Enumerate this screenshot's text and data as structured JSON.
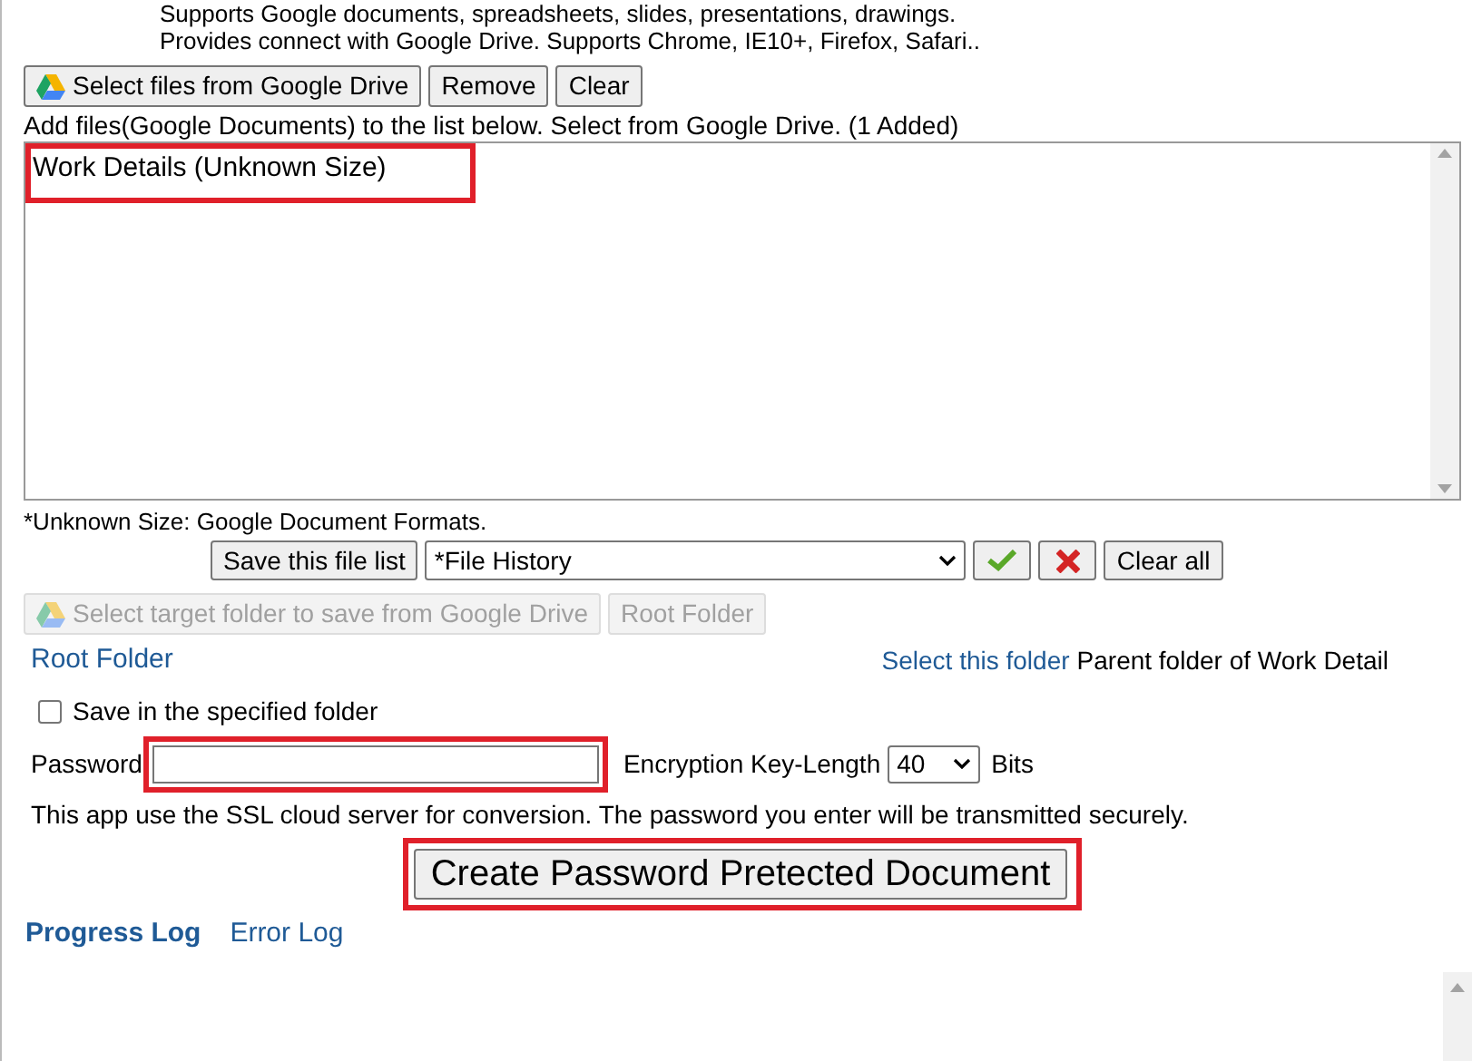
{
  "intro": [
    "Supports Google documents, spreadsheets, slides, presentations, drawings.",
    "Provides connect with Google Drive. Supports Chrome, IE10+, Firefox, Safari.."
  ],
  "file_buttons": [
    {
      "label": "Select files from Google Drive",
      "icon": true
    },
    {
      "label": "Remove",
      "icon": false
    },
    {
      "label": "Clear",
      "icon": false
    }
  ],
  "list_hint": "Add files(Google Documents) to the list below. Select from Google Drive. (1 Added)",
  "file_list": [
    {
      "label": "Work Details (Unknown Size)",
      "highlighted": true
    }
  ],
  "note": "*Unknown Size: Google Document Formats.",
  "history": {
    "save_button": "Save this file list",
    "select_value": "*File History",
    "clear_button": "Clear all"
  },
  "folder_buttons": [
    {
      "label": "Select target folder to save from Google Drive",
      "icon": true,
      "disabled": true
    },
    {
      "label": "Root Folder",
      "icon": false,
      "disabled": true
    }
  ],
  "folder_link": "Root Folder",
  "select_folder_link": "Select this folder",
  "parent_folder_text": "Parent folder of Work Detail",
  "save_in_folder": {
    "label": "Save in the specified folder",
    "checked": false
  },
  "password": {
    "label": "Password",
    "highlighted": true
  },
  "key_length": {
    "label": "Encryption Key-Length",
    "value": "40",
    "unit": "Bits"
  },
  "ssl_note": "This app use the SSL cloud server for conversion. The password you enter will be transmitted securely.",
  "create_button": {
    "label": "Create Password Pretected Document",
    "highlighted": true
  },
  "log_tabs": [
    {
      "label": "Progress Log",
      "selected": true
    },
    {
      "label": "Error Log",
      "selected": false
    }
  ]
}
